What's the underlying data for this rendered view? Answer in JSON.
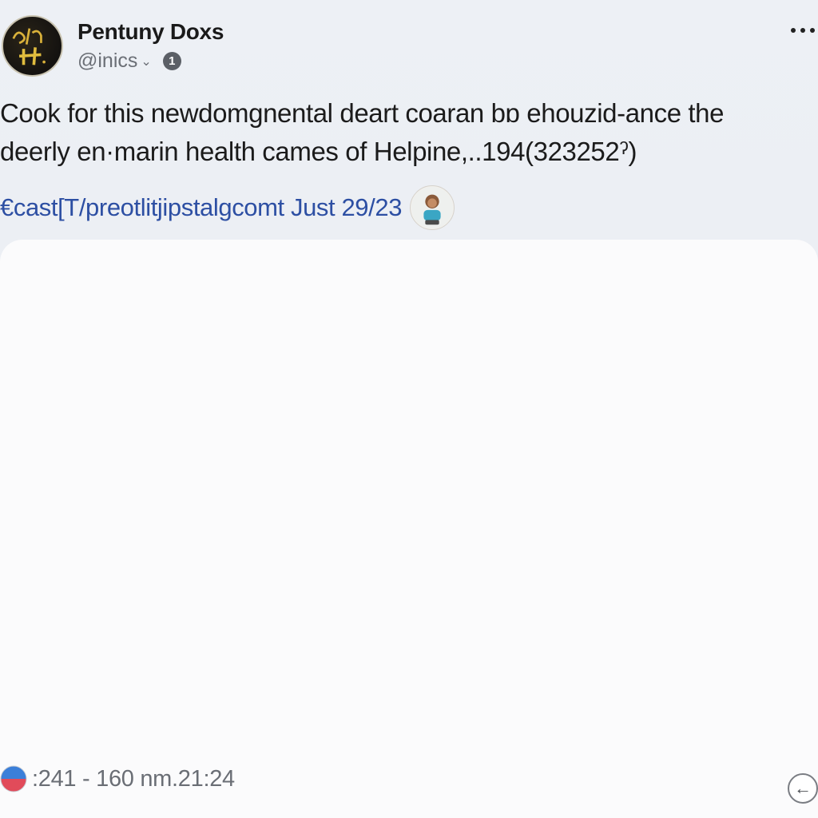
{
  "post": {
    "author_name": "Pentuny Doxs",
    "handle": "@inics",
    "handle_caret": "⌄",
    "info_badge": "1",
    "avatar_icon": "calligraphy-logo-avatar",
    "body_line1": "Cook for this newdomgnental deart coaran bɒ ehouzid-ance the",
    "body_line2": "deerly en·marin health cames of Helpine,..194(323252ˀ)",
    "link_text": "€cast[T/preotlitjipstalgcomt Just 29/23",
    "link_avatar_icon": "child-portrait-avatar",
    "footer_icon": "globe-icon",
    "timestamp": ":241 - 160 nm.21:24",
    "back_icon": "←"
  },
  "colors": {
    "link": "#2d4fa3",
    "page_bg": "#e9ecf2",
    "card_bg": "#fbfbfc",
    "muted_text": "#6a6e75"
  }
}
